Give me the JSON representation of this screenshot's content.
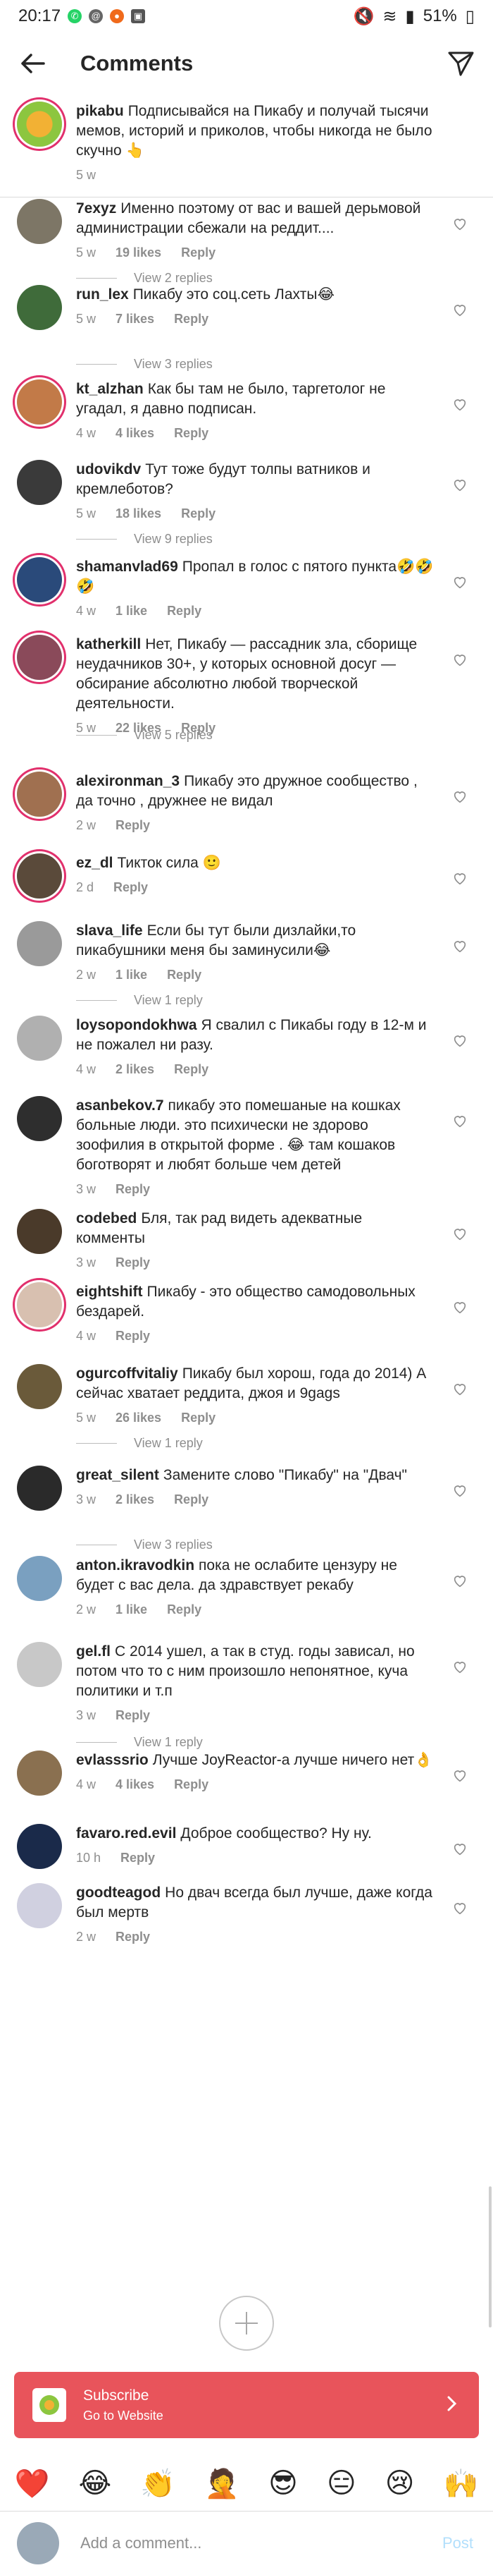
{
  "status_bar": {
    "time": "20:17",
    "battery": "51%"
  },
  "header": {
    "title": "Comments"
  },
  "caption": {
    "username": "pikabu",
    "text": "Подписывайся на Пикабу и получай тысячи мемов, историй и приколов, чтобы никогда не было скучно 👆",
    "time": "5 w"
  },
  "comments": [
    {
      "username": "7exyz",
      "text": "Именно поэтому от вас и вашей дерьмовой администрации сбежали на реддит....",
      "time": "5 w",
      "likes": "19 likes",
      "reply": "Reply",
      "replies": "View 2 replies",
      "avatar_color": "#7d7666"
    },
    {
      "username": "run_lex",
      "text": "Пикабу это соц.сеть Лахты😂",
      "time": "5 w",
      "likes": "7 likes",
      "reply": "Reply",
      "replies": "View 3 replies",
      "avatar_color": "#3f6b3a"
    },
    {
      "username": "kt_alzhan",
      "text": "Как бы там не было, таргетолог не угадал, я давно подписан.",
      "time": "4 w",
      "likes": "4 likes",
      "reply": "Reply",
      "replies": "",
      "avatar_color": "#c27a48",
      "story": true
    },
    {
      "username": "udovikdv",
      "text": "Тут тоже будут толпы ватников и кремлеботов?",
      "time": "5 w",
      "likes": "18 likes",
      "reply": "Reply",
      "replies": "View 9 replies",
      "avatar_color": "#3a3a3a"
    },
    {
      "username": "shamanvlad69",
      "text": "Пропал в голос с пятого пункта🤣🤣🤣",
      "time": "4 w",
      "likes": "1 like",
      "reply": "Reply",
      "replies": "",
      "avatar_color": "#2a4a7a",
      "story": true
    },
    {
      "username": "katherkill",
      "text": "Нет, Пикабу — рассадник зла, сборище неудачников 30+, у которых основной досуг — обсирание абсолютно любой творческой деятельности.",
      "time": "5 w",
      "likes": "22 likes",
      "reply": "Reply",
      "replies": "View 5 replies",
      "avatar_color": "#8a4a5a",
      "story": true
    },
    {
      "username": "alexironman_3",
      "text": "Пикабу это дружное сообщество , да точно , дружнее не видал",
      "time": "2 w",
      "likes": "",
      "reply": "Reply",
      "replies": "",
      "avatar_color": "#a07050",
      "story": true
    },
    {
      "username": "ez_dl",
      "text": "Тикток сила 🙂",
      "time": "2 d",
      "likes": "",
      "reply": "Reply",
      "replies": "",
      "avatar_color": "#5a4a3a",
      "story": true
    },
    {
      "username": "slava_life",
      "text": "Если бы тут были дизлайки,то пикабушники меня бы заминусили😂",
      "time": "2 w",
      "likes": "1 like",
      "reply": "Reply",
      "replies": "View 1 reply",
      "avatar_color": "#9a9a9a"
    },
    {
      "username": "loysopondokhwa",
      "text": "Я свалил с Пикабы году в 12-м и не пожалел ни разу.",
      "time": "4 w",
      "likes": "2 likes",
      "reply": "Reply",
      "replies": "",
      "avatar_color": "#b0b0b0"
    },
    {
      "username": "asanbekov.7",
      "text": "пикабу это помешаные на кошках больные люди. это психически не здорово зоофилия в открытой форме . 😂 там кошаков боготворят и любят больше чем детей",
      "time": "3 w",
      "likes": "",
      "reply": "Reply",
      "replies": "",
      "avatar_color": "#2e2e2e"
    },
    {
      "username": "codebed",
      "text": "Бля, так рад видеть адекватные комменты",
      "time": "3 w",
      "likes": "",
      "reply": "Reply",
      "replies": "",
      "avatar_color": "#4a3a2a"
    },
    {
      "username": "eightshift",
      "text": "Пикабу - это общество самодовольных бездарей.",
      "time": "4 w",
      "likes": "",
      "reply": "Reply",
      "replies": "",
      "avatar_color": "#d8c0b0",
      "story": true
    },
    {
      "username": "ogurcoffvitaliy",
      "text": "Пикабу был хорош, года до 2014) А сейчас хватает реддита, джоя и 9gags",
      "time": "5 w",
      "likes": "26 likes",
      "reply": "Reply",
      "replies": "View 1 reply",
      "avatar_color": "#6a5a3a"
    },
    {
      "username": "great_silent",
      "text": "Замените  слово \"Пикабу\"  на \"Двач\"",
      "time": "3 w",
      "likes": "2 likes",
      "reply": "Reply",
      "replies": "View 3 replies",
      "avatar_color": "#2a2a2a"
    },
    {
      "username": "anton.ikravodkin",
      "text": "пока не ослабите цензуру не будет с вас дела. да здравствует рекабу",
      "time": "2 w",
      "likes": "1 like",
      "reply": "Reply",
      "replies": "",
      "avatar_color": "#7aa0c0"
    },
    {
      "username": "gel.fl",
      "text": "С 2014 ушел, а так в студ. годы зависал, но потом что то с ним произошло непонятное, куча политики и т.п",
      "time": "3 w",
      "likes": "",
      "reply": "Reply",
      "replies": "View 1 reply",
      "avatar_color": "#c8c8c8"
    },
    {
      "username": "evlasssrio",
      "text": "Лучше JoyReactor-а лучше ничего нет👌",
      "time": "4 w",
      "likes": "4 likes",
      "reply": "Reply",
      "replies": "",
      "avatar_color": "#8a7050"
    },
    {
      "username": "favaro.red.evil",
      "text": "Доброе сообщество? Ну ну.",
      "time": "10 h",
      "likes": "",
      "reply": "Reply",
      "replies": "",
      "avatar_color": "#1a2a4a"
    },
    {
      "username": "goodteagod",
      "text": "Но двач всегда был лучше, даже когда был мертв",
      "time": "2 w",
      "likes": "",
      "reply": "Reply",
      "replies": "",
      "avatar_color": "#d0d0e0"
    }
  ],
  "banner": {
    "title": "Subscribe",
    "subtitle": "Go to Website"
  },
  "emoji_bar": [
    "❤️",
    "😂",
    "👏",
    "🤦",
    "😎",
    "😑",
    "😢",
    "🙌"
  ],
  "composer": {
    "placeholder": "Add a comment...",
    "post": "Post"
  }
}
